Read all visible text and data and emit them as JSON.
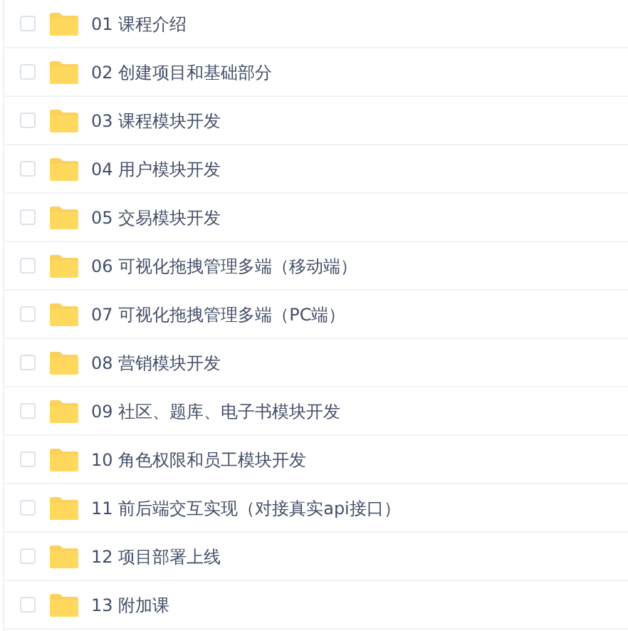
{
  "folders": [
    {
      "label": "01 课程介绍",
      "checked": false
    },
    {
      "label": "02 创建项目和基础部分",
      "checked": false
    },
    {
      "label": "03 课程模块开发",
      "checked": false
    },
    {
      "label": "04 用户模块开发",
      "checked": false
    },
    {
      "label": "05 交易模块开发",
      "checked": false
    },
    {
      "label": "06 可视化拖拽管理多端（移动端）",
      "checked": false
    },
    {
      "label": "07 可视化拖拽管理多端（PC端）",
      "checked": false
    },
    {
      "label": "08 营销模块开发",
      "checked": false
    },
    {
      "label": "09 社区、题库、电子书模块开发",
      "checked": false
    },
    {
      "label": "10 角色权限和员工模块开发",
      "checked": false
    },
    {
      "label": "11 前后端交互实现（对接真实api接口）",
      "checked": false
    },
    {
      "label": "12 项目部署上线",
      "checked": false
    },
    {
      "label": "13 附加课",
      "checked": false
    }
  ]
}
